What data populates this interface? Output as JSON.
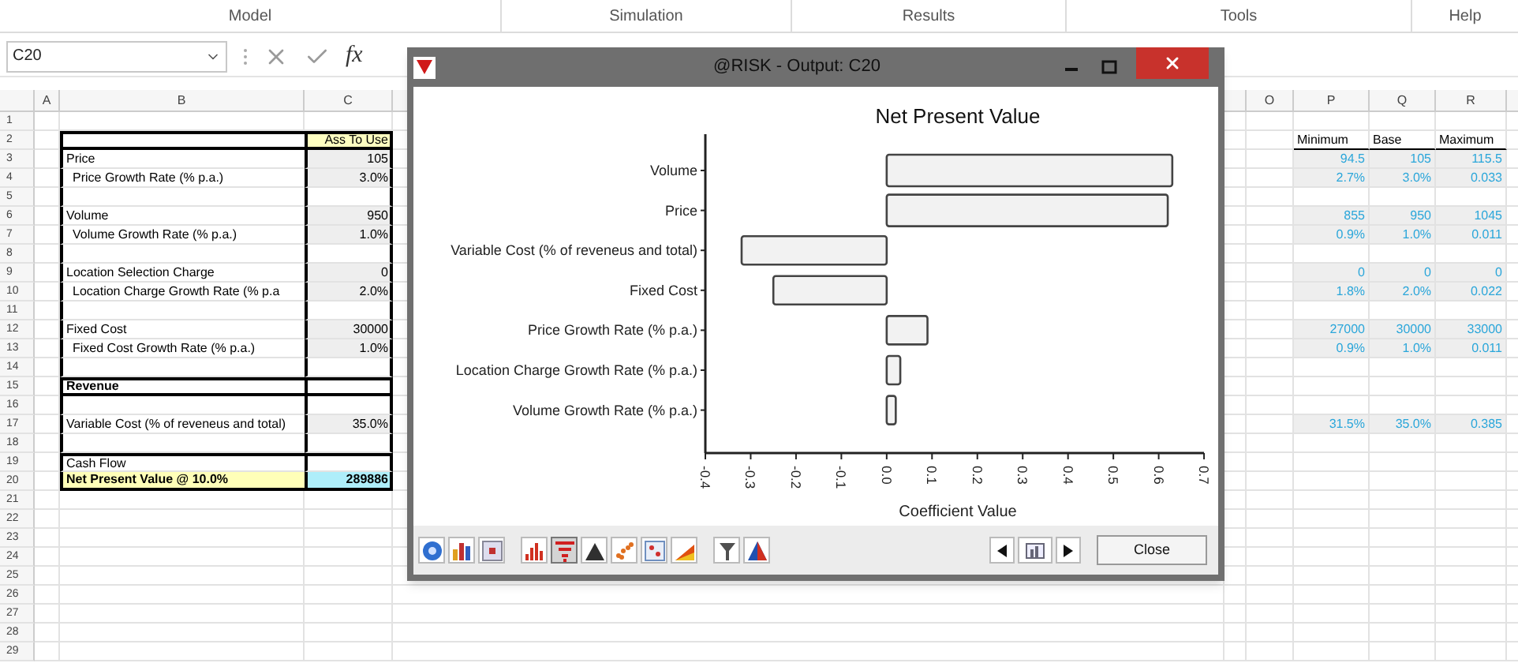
{
  "ribbon": {
    "groups": [
      "Model",
      "Simulation",
      "Results",
      "Tools",
      "Help"
    ]
  },
  "formula_bar": {
    "name_box": "C20",
    "function_label": "fx"
  },
  "sheet": {
    "columns": [
      "A",
      "B",
      "C",
      "O",
      "P",
      "Q",
      "R"
    ],
    "rows": [
      {
        "number": "1",
        "kind": "empty"
      },
      {
        "number": "2",
        "kind": "header",
        "value": "Ass To Use",
        "minimum": "Minimum",
        "base": "Base",
        "maximum": "Maximum"
      },
      {
        "number": "3",
        "kind": "item",
        "label": "Price",
        "value": "105",
        "minimum": "94.5",
        "base": "105",
        "maximum": "115.5"
      },
      {
        "number": "4",
        "kind": "sub",
        "label": "Price Growth Rate (% p.a.)",
        "value": "3.0%",
        "minimum": "2.7%",
        "base": "3.0%",
        "maximum": "0.033"
      },
      {
        "number": "5",
        "kind": "blank"
      },
      {
        "number": "6",
        "kind": "item",
        "label": "Volume",
        "value": "950",
        "minimum": "855",
        "base": "950",
        "maximum": "1045"
      },
      {
        "number": "7",
        "kind": "sub",
        "label": "Volume Growth Rate (% p.a.)",
        "value": "1.0%",
        "minimum": "0.9%",
        "base": "1.0%",
        "maximum": "0.011"
      },
      {
        "number": "8",
        "kind": "blank"
      },
      {
        "number": "9",
        "kind": "item",
        "label": "Location Selection Charge",
        "value": "0",
        "minimum": "0",
        "base": "0",
        "maximum": "0"
      },
      {
        "number": "10",
        "kind": "sub",
        "label": "Location Charge Growth Rate (% p.a",
        "value": "2.0%",
        "minimum": "1.8%",
        "base": "2.0%",
        "maximum": "0.022"
      },
      {
        "number": "11",
        "kind": "blank"
      },
      {
        "number": "12",
        "kind": "item",
        "label": "Fixed Cost",
        "value": "30000",
        "minimum": "27000",
        "base": "30000",
        "maximum": "33000"
      },
      {
        "number": "13",
        "kind": "sub",
        "label": "Fixed Cost Growth Rate (% p.a.)",
        "value": "1.0%",
        "minimum": "0.9%",
        "base": "1.0%",
        "maximum": "0.011"
      },
      {
        "number": "14",
        "kind": "blank"
      },
      {
        "number": "15",
        "kind": "section",
        "label": "Revenue"
      },
      {
        "number": "16",
        "kind": "blank"
      },
      {
        "number": "17",
        "kind": "item",
        "label": "Variable Cost (% of reveneus and total)",
        "value": "35.0%",
        "minimum": "31.5%",
        "base": "35.0%",
        "maximum": "0.385"
      },
      {
        "number": "18",
        "kind": "blank"
      },
      {
        "number": "19",
        "kind": "subtotal",
        "label": "Cash Flow"
      },
      {
        "number": "20",
        "kind": "total",
        "label": "Net Present Value @ 10.0%",
        "value": "289886"
      },
      {
        "number": "21",
        "kind": "empty"
      },
      {
        "number": "22",
        "kind": "empty"
      },
      {
        "number": "23",
        "kind": "empty"
      },
      {
        "number": "24",
        "kind": "empty"
      },
      {
        "number": "25",
        "kind": "empty"
      },
      {
        "number": "26",
        "kind": "empty"
      },
      {
        "number": "27",
        "kind": "empty"
      },
      {
        "number": "28",
        "kind": "empty"
      },
      {
        "number": "29",
        "kind": "empty"
      }
    ]
  },
  "dialog": {
    "title": "@RISK - Output: C20",
    "chart_data": {
      "type": "bar",
      "orientation": "horizontal",
      "title": "Net Present Value",
      "xlabel": "Coefficient Value",
      "categories": [
        "Volume",
        "Price",
        "Variable Cost (% of reveneus and total)",
        "Fixed Cost",
        "Price Growth Rate (% p.a.)",
        "Location Charge Growth Rate (% p.a.)",
        "Volume Growth Rate (% p.a.)"
      ],
      "values": [
        0.63,
        0.62,
        -0.32,
        -0.25,
        0.09,
        0.03,
        0.02
      ],
      "xlim": [
        -0.4,
        0.7
      ],
      "xticks": [
        {
          "value": -0.4,
          "label": "-0.4"
        },
        {
          "value": -0.3,
          "label": "-0.3"
        },
        {
          "value": -0.2,
          "label": "-0.2"
        },
        {
          "value": -0.1,
          "label": "-0.1"
        },
        {
          "value": 0,
          "label": "0.0"
        },
        {
          "value": 0.1,
          "label": "0.1"
        },
        {
          "value": 0.2,
          "label": "0.2"
        },
        {
          "value": 0.3,
          "label": "0.3"
        },
        {
          "value": 0.4,
          "label": "0.4"
        },
        {
          "value": 0.5,
          "label": "0.5"
        },
        {
          "value": 0.6,
          "label": "0.6"
        },
        {
          "value": 0.7,
          "label": "0.7"
        }
      ]
    },
    "toolbar": [
      {
        "kind": "help",
        "selected": false
      },
      {
        "kind": "bars",
        "selected": false
      },
      {
        "kind": "settings",
        "selected": false
      },
      {
        "kind": "histogram",
        "selected": false
      },
      {
        "kind": "tornado",
        "selected": true
      },
      {
        "kind": "mountain",
        "selected": false
      },
      {
        "kind": "scatter",
        "selected": false
      },
      {
        "kind": "matrix",
        "selected": false
      },
      {
        "kind": "ramp",
        "selected": false
      },
      {
        "kind": "filter",
        "selected": false
      },
      {
        "kind": "triangle",
        "selected": false
      }
    ],
    "close_label": "Close"
  }
}
